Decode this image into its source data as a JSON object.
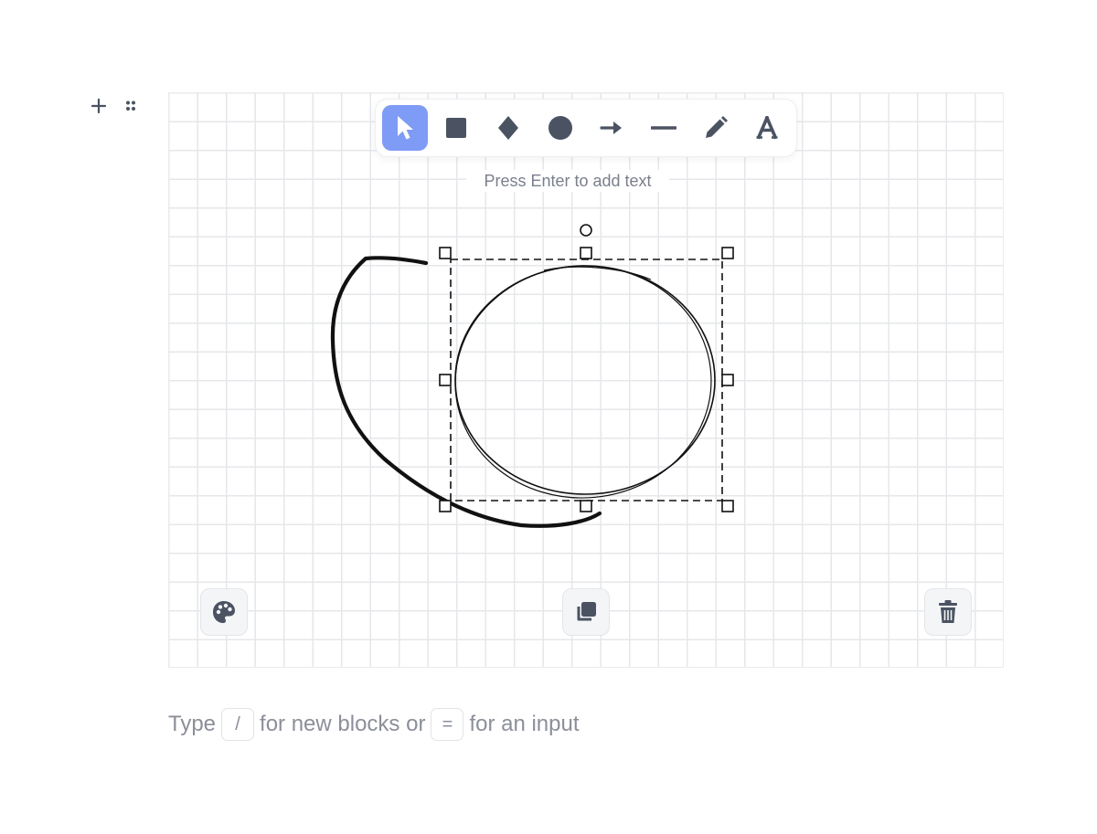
{
  "toolbar": {
    "tools": [
      {
        "name": "select",
        "icon": "cursor-icon",
        "active": true
      },
      {
        "name": "rectangle",
        "icon": "square-icon"
      },
      {
        "name": "diamond",
        "icon": "diamond-icon"
      },
      {
        "name": "ellipse",
        "icon": "circle-icon"
      },
      {
        "name": "arrow",
        "icon": "arrow-right-icon"
      },
      {
        "name": "line",
        "icon": "line-icon"
      },
      {
        "name": "draw",
        "icon": "pencil-icon"
      },
      {
        "name": "text",
        "icon": "text-icon"
      }
    ],
    "active_color": "#7e9bf5",
    "icon_color": "#4b5363"
  },
  "canvas": {
    "hint": "Press Enter to add text"
  },
  "actions": {
    "style_icon": "palette-icon",
    "duplicate_icon": "copy-icon",
    "delete_icon": "trash-icon"
  },
  "placeholder": {
    "prefix": "Type",
    "slash_key": "/",
    "middle": "for new blocks or",
    "equals_key": "=",
    "suffix": "for an input"
  }
}
